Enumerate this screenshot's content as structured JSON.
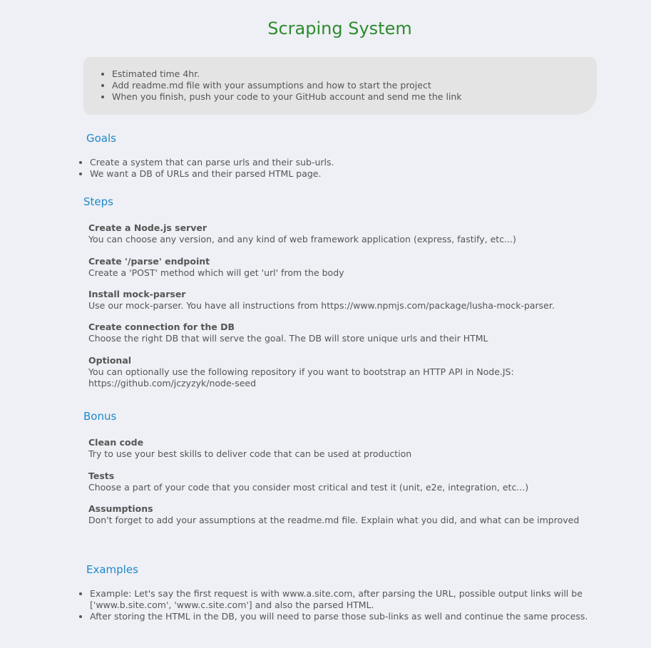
{
  "title": "Scraping System",
  "notes": [
    "Estimated time 4hr.",
    "Add readme.md file with your assumptions and how to start the project",
    "When you finish, push your code to your GitHub account and send me the link"
  ],
  "goals": {
    "heading": "Goals",
    "items": [
      "Create a system that can parse urls and their sub-urls.",
      "We want a DB of URLs and their parsed HTML page."
    ]
  },
  "steps": {
    "heading": "Steps",
    "items": [
      {
        "name": "Create a Node.js server",
        "desc": "You can choose any version, and any kind of web framework application (express, fastify, etc...)"
      },
      {
        "name": "Create '/parse' endpoint",
        "desc": "Create a 'POST' method which will get 'url' from the body"
      },
      {
        "name": "Install mock-parser",
        "desc": "Use our mock-parser. You have all instructions from https://www.npmjs.com/package/lusha-mock-parser."
      },
      {
        "name": "Create connection for the DB",
        "desc": "Choose the right DB that will serve the goal. The DB will store unique urls and their HTML"
      },
      {
        "name": "Optional",
        "desc": "You can optionally use the following repository if you want to bootstrap an HTTP API in Node.JS:",
        "desc2": "https://github.com/jczyzyk/node-seed"
      }
    ]
  },
  "bonus": {
    "heading": "Bonus",
    "items": [
      {
        "name": "Clean code",
        "desc": "Try to use your best skills to deliver code that can be used at production"
      },
      {
        "name": "Tests",
        "desc": "Choose a part of your code that you consider most critical and test it (unit, e2e, integration, etc...)"
      },
      {
        "name": "Assumptions",
        "desc": "Don't forget to add your assumptions at the readme.md file. Explain what you did, and what can be improved"
      }
    ]
  },
  "examples": {
    "heading": "Examples",
    "items": [
      {
        "line1": "Example: Let's say the first request is with www.a.site.com, after parsing the URL, possible output links will be",
        "line2": "['www.b.site.com', 'www.c.site.com'] and also the parsed HTML."
      },
      {
        "line1": "After storing the HTML in the DB, you will need to parse those sub-links as well and continue the same process.",
        "line2": ""
      }
    ]
  }
}
